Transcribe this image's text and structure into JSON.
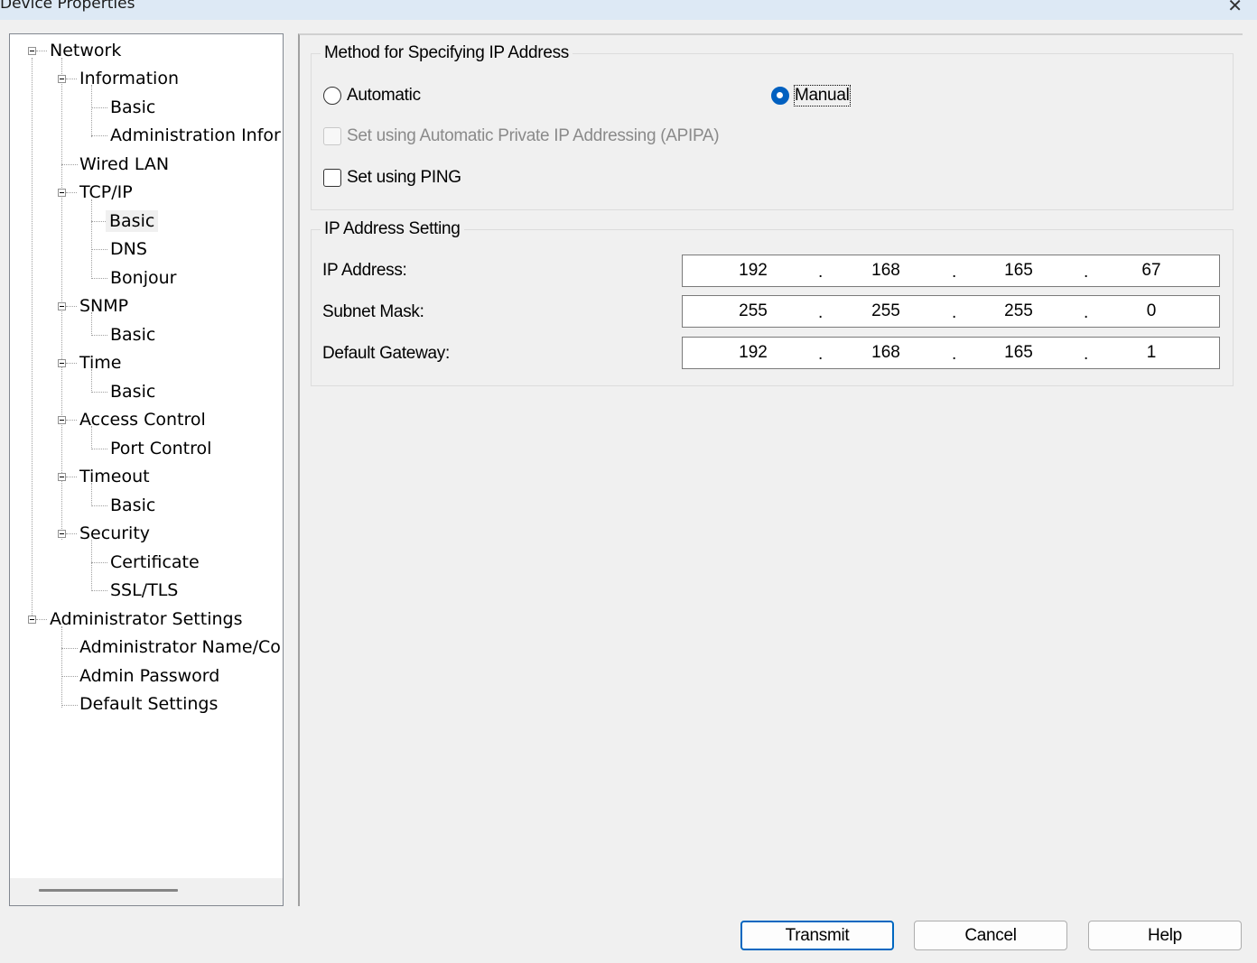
{
  "window": {
    "title": "Device Properties",
    "close_glyph": "✕"
  },
  "tree": {
    "items": [
      {
        "label": "Network"
      },
      {
        "label": "Information"
      },
      {
        "label": "Basic"
      },
      {
        "label": "Administration Infor"
      },
      {
        "label": "Wired LAN"
      },
      {
        "label": "TCP/IP"
      },
      {
        "label": "Basic"
      },
      {
        "label": "DNS"
      },
      {
        "label": "Bonjour"
      },
      {
        "label": "SNMP"
      },
      {
        "label": "Basic"
      },
      {
        "label": "Time"
      },
      {
        "label": "Basic"
      },
      {
        "label": "Access Control"
      },
      {
        "label": "Port Control"
      },
      {
        "label": "Timeout"
      },
      {
        "label": "Basic"
      },
      {
        "label": "Security"
      },
      {
        "label": "Certificate"
      },
      {
        "label": "SSL/TLS"
      },
      {
        "label": "Administrator Settings"
      },
      {
        "label": "Administrator Name/Co"
      },
      {
        "label": "Admin Password"
      },
      {
        "label": "Default Settings"
      }
    ],
    "selected_index": 6
  },
  "method_group": {
    "caption": "Method for Specifying IP Address",
    "automatic_label": "Automatic",
    "manual_label": "Manual",
    "selected": "Manual",
    "apipa_label": "Set using Automatic Private IP Addressing (APIPA)",
    "apipa_enabled": false,
    "apipa_checked": false,
    "ping_label": "Set using PING",
    "ping_checked": false
  },
  "ip_group": {
    "caption": "IP Address Setting",
    "fields": [
      {
        "label": "IP Address:",
        "octets": [
          "192",
          "168",
          "165",
          "67"
        ]
      },
      {
        "label": "Subnet Mask:",
        "octets": [
          "255",
          "255",
          "255",
          "0"
        ]
      },
      {
        "label": "Default Gateway:",
        "octets": [
          "192",
          "168",
          "165",
          "1"
        ]
      }
    ],
    "separator": "."
  },
  "buttons": {
    "transmit": "Transmit",
    "cancel": "Cancel",
    "help": "Help"
  },
  "colors": {
    "accent": "#0060c0",
    "titlebar": "#dde9f5",
    "background": "#f0f0f0"
  }
}
